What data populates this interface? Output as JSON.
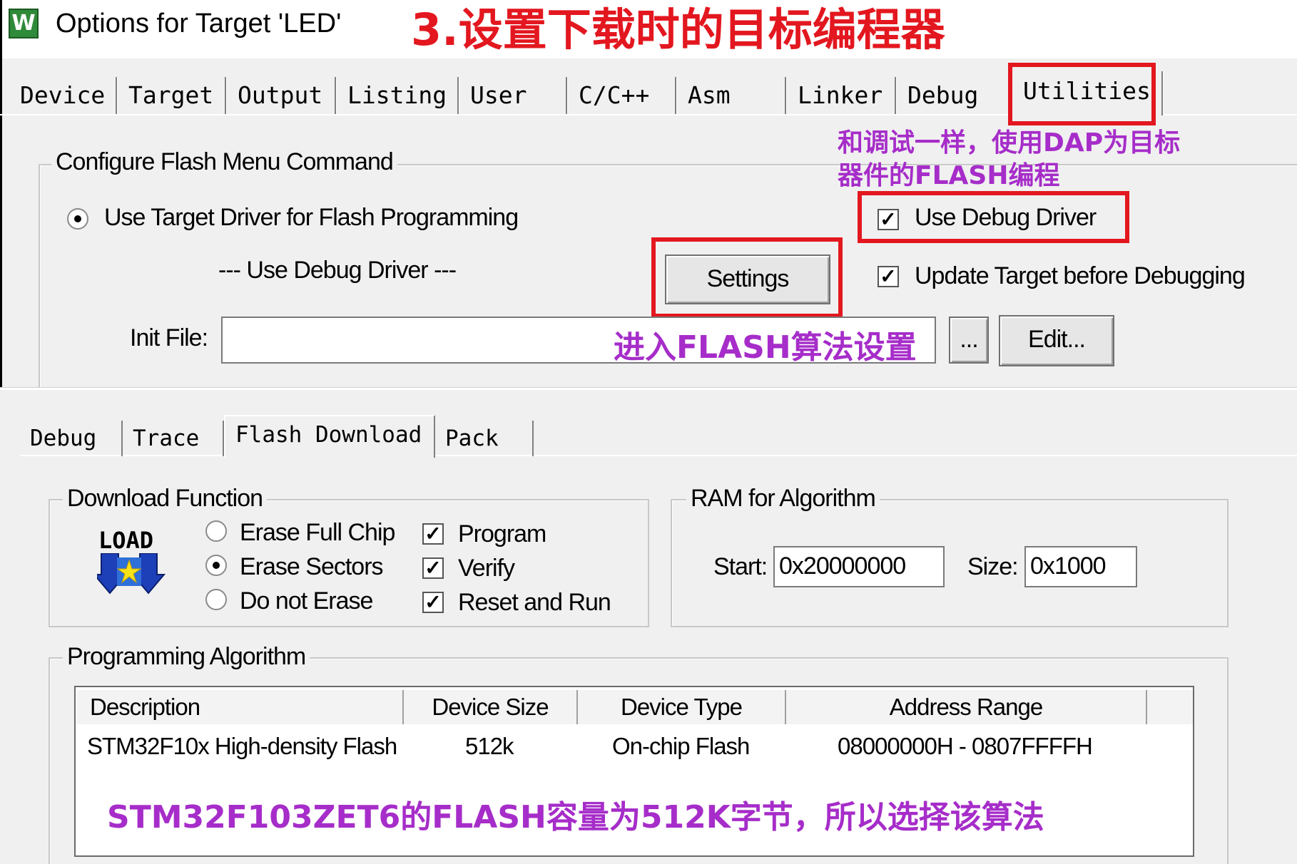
{
  "top_dialog": {
    "title": "Options for Target 'LED'",
    "icon": "keil-uvision-icon",
    "tabs": [
      "Device",
      "Target",
      "Output",
      "Listing",
      "User",
      "C/C++",
      "Asm",
      "Linker",
      "Debug",
      "Utilities"
    ],
    "active_tab": "Utilities",
    "flash_group": {
      "legend": "Configure Flash Menu Command",
      "use_target_driver_label": "Use Target Driver for Flash Programming",
      "use_target_driver_selected": true,
      "driver_name": "--- Use Debug Driver ---",
      "settings_button": "Settings",
      "use_debug_driver_label": "Use Debug Driver",
      "use_debug_driver_checked": true,
      "update_target_label": "Update Target before Debugging",
      "update_target_checked": true,
      "init_file_label": "Init File:",
      "init_file_value": "",
      "browse_button": "...",
      "edit_button": "Edit..."
    }
  },
  "bottom_dialog": {
    "tabs": [
      "Debug",
      "Trace",
      "Flash Download",
      "Pack"
    ],
    "active_tab": "Flash Download",
    "download_function": {
      "legend": "Download Function",
      "logo_text": "LOAD",
      "erase_options": [
        {
          "label": "Erase Full Chip",
          "selected": false
        },
        {
          "label": "Erase Sectors",
          "selected": true
        },
        {
          "label": "Do not Erase",
          "selected": false
        }
      ],
      "checks": [
        {
          "label": "Program",
          "checked": true
        },
        {
          "label": "Verify",
          "checked": true
        },
        {
          "label": "Reset and Run",
          "checked": true
        }
      ]
    },
    "ram": {
      "legend": "RAM for Algorithm",
      "start_label": "Start:",
      "start_value": "0x20000000",
      "size_label": "Size:",
      "size_value": "0x1000"
    },
    "algorithm": {
      "legend": "Programming Algorithm",
      "columns": [
        "Description",
        "Device Size",
        "Device Type",
        "Address Range"
      ],
      "rows": [
        {
          "description": "STM32F10x High-density Flash",
          "size": "512k",
          "type": "On-chip Flash",
          "range": "08000000H - 0807FFFFH"
        }
      ]
    }
  },
  "annotations": {
    "heading": "3.设置下载时的目标编程器",
    "debug_note_line1": "和调试一样，使用DAP为目标",
    "debug_note_line2": "器件的FLASH编程",
    "settings_note": "进入FLASH算法设置",
    "algo_note": "STM32F103ZET6的FLASH容量为512K字节，所以选择该算法",
    "red_color": "#e3171f",
    "purple_color": "#a62dc9"
  }
}
